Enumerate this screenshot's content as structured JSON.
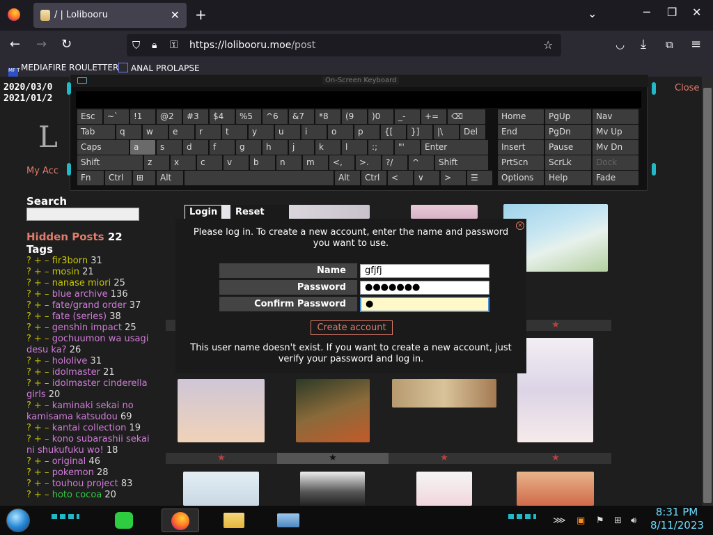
{
  "browser": {
    "tab_title": "/ | Lolibooru",
    "url_host": "https://lolibooru.moe",
    "url_path": "/post",
    "new_tab_symbol": "+",
    "bookmarks": [
      "MEDIAFIRE ROULETTER",
      "ANAL PROLAPSE"
    ]
  },
  "page": {
    "dates": [
      "2020/03/0",
      "2021/01/2"
    ],
    "close_label": "Close",
    "logo_letter": "L",
    "my_account": "My Acc",
    "search_heading": "Search",
    "hidden_posts_label": "Hidden Posts",
    "hidden_posts_count": "22",
    "tags_heading": "Tags",
    "tags": [
      {
        "name": "fir3born",
        "count": "31",
        "kind": "gen"
      },
      {
        "name": "mosin",
        "count": "21",
        "kind": "gen"
      },
      {
        "name": "nanase miori",
        "count": "25",
        "kind": "gen"
      },
      {
        "name": "blue archive",
        "count": "136",
        "kind": "copy"
      },
      {
        "name": "fate/grand order",
        "count": "37",
        "kind": "copy"
      },
      {
        "name": "fate (series)",
        "count": "38",
        "kind": "copy"
      },
      {
        "name": "genshin impact",
        "count": "25",
        "kind": "copy"
      },
      {
        "name": "gochuumon wa usagi desu ka?",
        "count": "26",
        "kind": "copy"
      },
      {
        "name": "hololive",
        "count": "31",
        "kind": "copy"
      },
      {
        "name": "idolmaster",
        "count": "21",
        "kind": "copy"
      },
      {
        "name": "idolmaster cinderella girls",
        "count": "20",
        "kind": "copy"
      },
      {
        "name": "kaminaki sekai no kamisama katsudou",
        "count": "69",
        "kind": "copy"
      },
      {
        "name": "kantai collection",
        "count": "19",
        "kind": "copy"
      },
      {
        "name": "kono subarashii sekai ni shukufuku wo!",
        "count": "18",
        "kind": "copy"
      },
      {
        "name": "original",
        "count": "46",
        "kind": "copy"
      },
      {
        "name": "pokemon",
        "count": "28",
        "kind": "copy"
      },
      {
        "name": "touhou project",
        "count": "83",
        "kind": "copy"
      },
      {
        "name": "hoto cocoa",
        "count": "20",
        "kind": "char"
      }
    ],
    "tag_ops": "? + –",
    "star": "★"
  },
  "login": {
    "tab_login": "Login",
    "tab_reset": "Reset Password",
    "close_symbol": "×",
    "message": "Please log in. To create a new account, enter the name and password you want to use.",
    "name_label": "Name",
    "name_value": "gfjfj",
    "password_label": "Password",
    "password_value": "●●●●●●●",
    "confirm_label": "Confirm Password",
    "confirm_value": "●",
    "create_button": "Create account",
    "note": "This user name doesn't exist. If you want to create a new account, just verify your password and log in."
  },
  "osk": {
    "title": "On-Screen Keyboard",
    "row1": [
      "Esc",
      "~`",
      "!1",
      "@2",
      "#3",
      "$4",
      "%5",
      "^6",
      "&7",
      "*8",
      "(9",
      ")0",
      "_-",
      "+=",
      "⌫"
    ],
    "row2": [
      "Tab",
      "q",
      "w",
      "e",
      "r",
      "t",
      "y",
      "u",
      "i",
      "o",
      "p",
      "{[",
      "}]",
      "|\\",
      "Del"
    ],
    "row3": [
      "Caps",
      "a",
      "s",
      "d",
      "f",
      "g",
      "h",
      "j",
      "k",
      "l",
      ":;",
      "\"'",
      "Enter"
    ],
    "row4": [
      "Shift",
      "z",
      "x",
      "c",
      "v",
      "b",
      "n",
      "m",
      "<,",
      ">.",
      "?/",
      "^",
      "Shift"
    ],
    "row5": [
      "Fn",
      "Ctrl",
      "⊞",
      "Alt",
      "",
      "Alt",
      "Ctrl",
      "<",
      "∨",
      ">",
      "☰"
    ],
    "nav_keys": [
      [
        "Home",
        "PgUp",
        "Nav"
      ],
      [
        "End",
        "PgDn",
        "Mv Up"
      ],
      [
        "Insert",
        "Pause",
        "Mv Dn"
      ],
      [
        "PrtScn",
        "ScrLk",
        "Dock"
      ],
      [
        "Options",
        "Help",
        "Fade"
      ]
    ]
  },
  "taskbar": {
    "time": "8:31 PM",
    "date": "8/11/2023"
  }
}
